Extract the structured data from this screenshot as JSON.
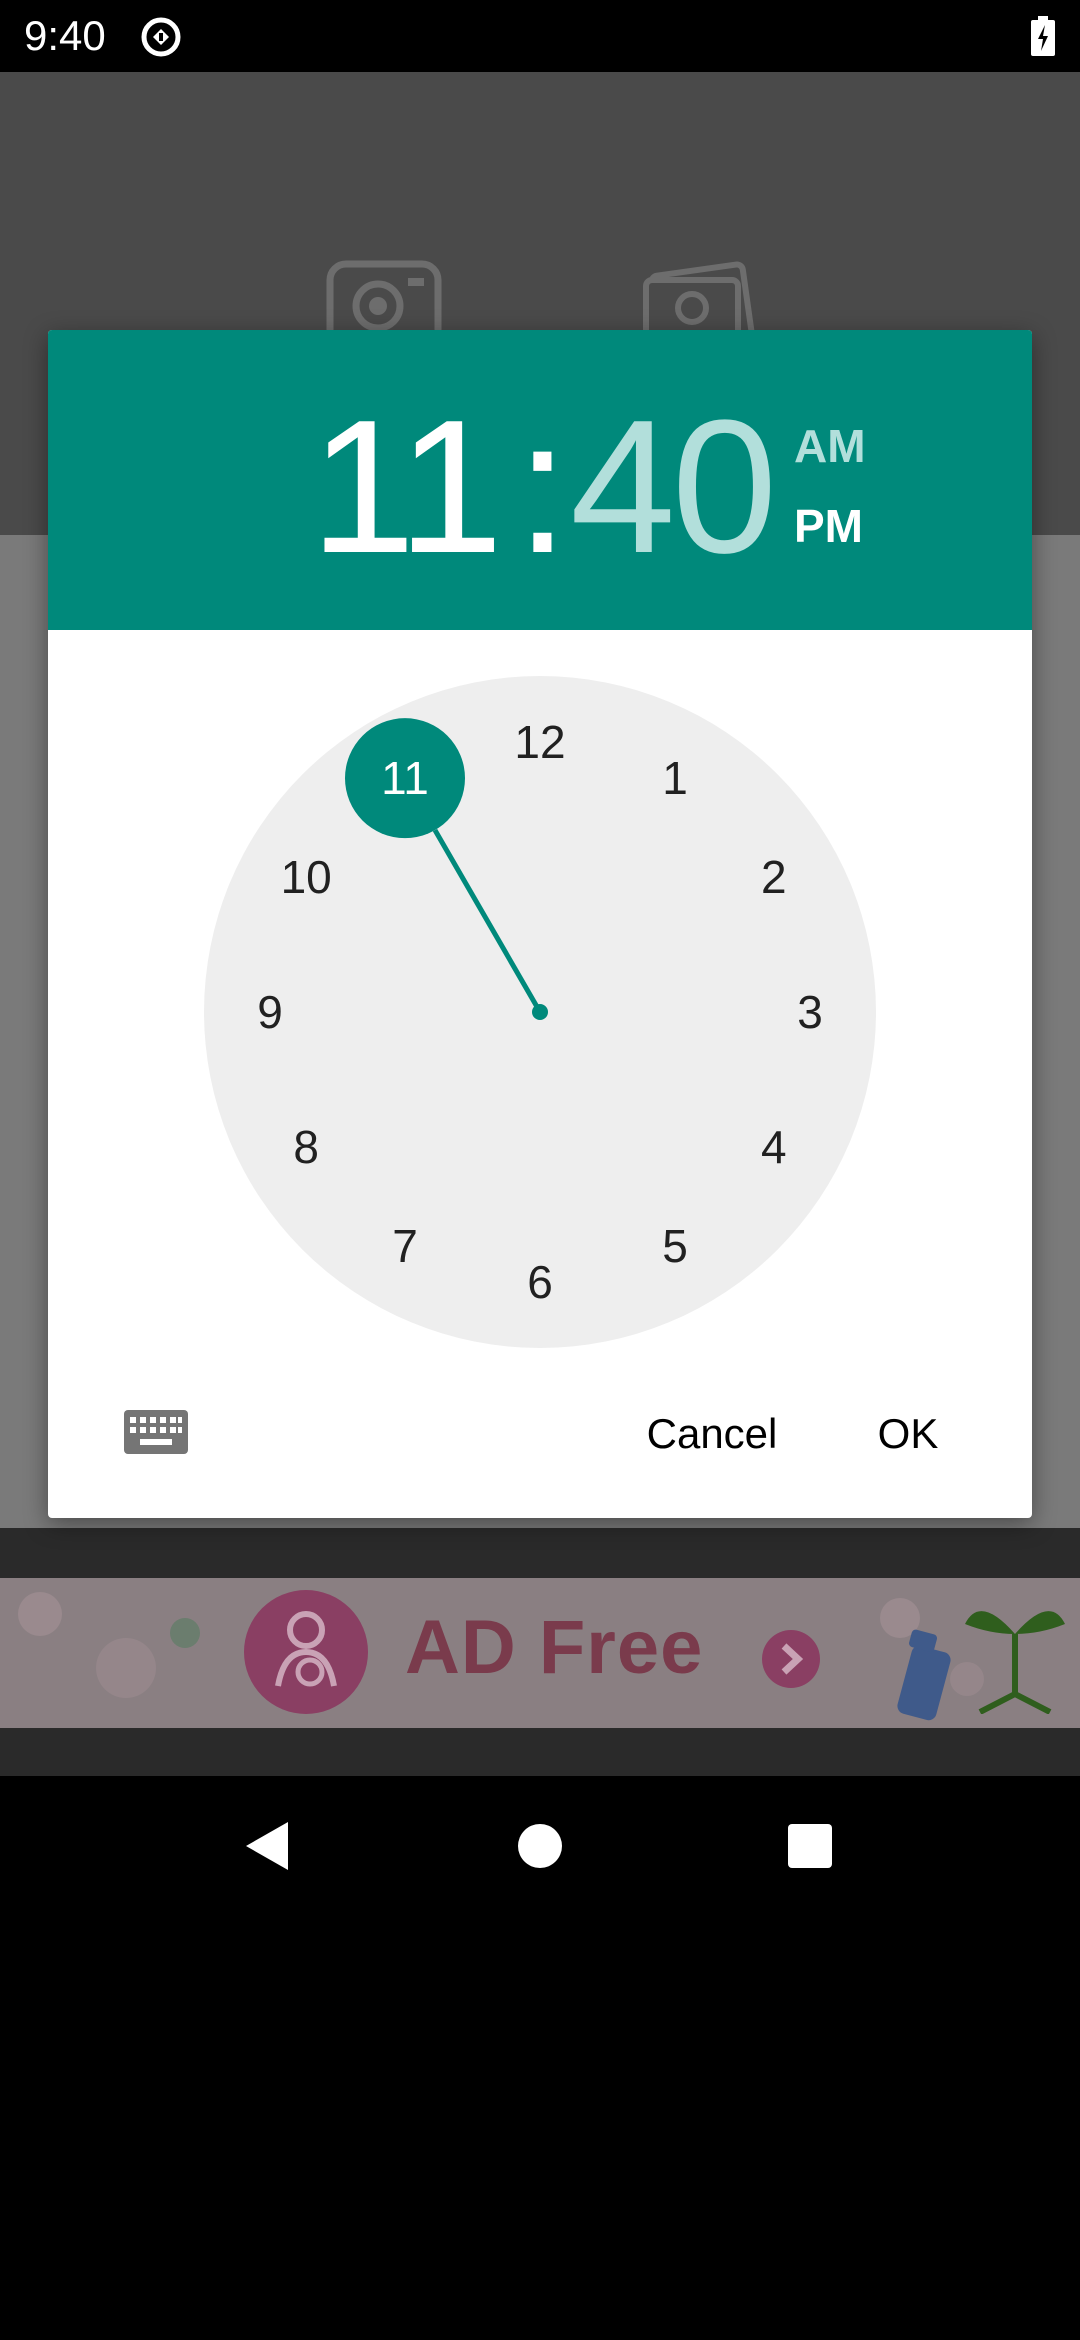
{
  "status_bar": {
    "time": "9:40",
    "sync_icon": "sync-circle-icon",
    "battery_icon": "battery-charging-icon"
  },
  "app": {
    "header_icons": [
      "camera-icon",
      "gallery-portrait-icon"
    ],
    "ad_banner": {
      "text": "AD Free",
      "icon": "baby-logo-icon"
    }
  },
  "dialog": {
    "hour": "11",
    "separator": ":",
    "minute": "40",
    "am_label": "AM",
    "pm_label": "PM",
    "selected_period": "PM",
    "clock_numbers": [
      "12",
      "1",
      "2",
      "3",
      "4",
      "5",
      "6",
      "7",
      "8",
      "9",
      "10",
      "11"
    ],
    "selected_number": "11",
    "keyboard_icon": "keyboard-icon",
    "cancel_label": "Cancel",
    "ok_label": "OK",
    "accent_color": "#00897b",
    "face_color": "#eeeeee"
  },
  "nav_bar": {
    "back_icon": "back-triangle-icon",
    "home_icon": "home-circle-icon",
    "recents_icon": "recents-square-icon"
  }
}
